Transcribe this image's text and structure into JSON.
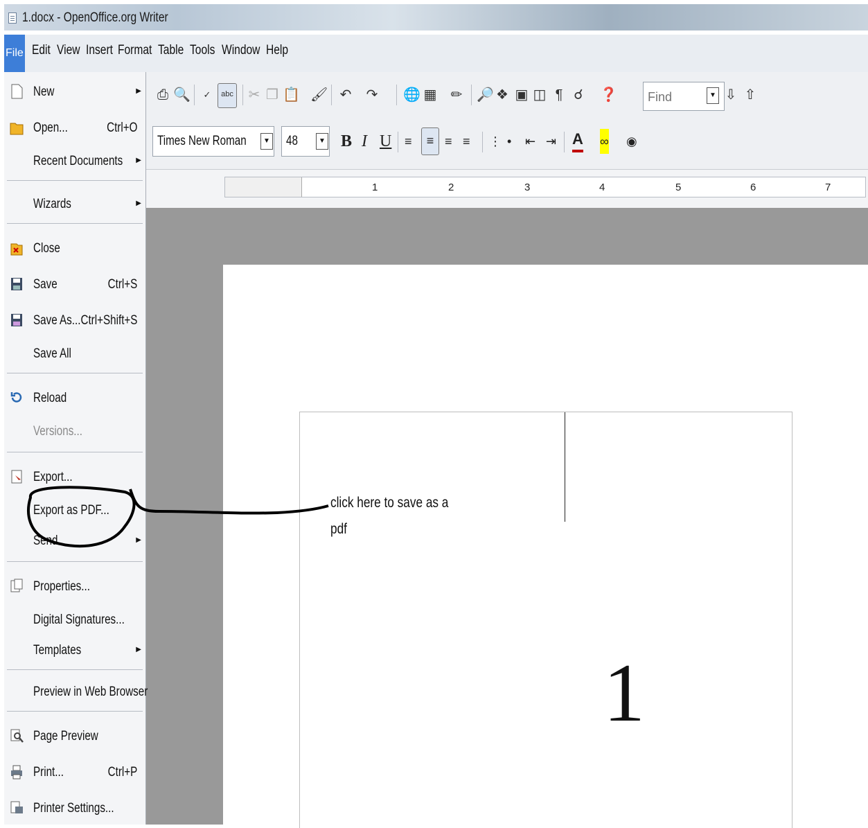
{
  "window": {
    "title": "1.docx - OpenOffice.org Writer"
  },
  "menubar": {
    "items": [
      "File",
      "Edit",
      "View",
      "Insert",
      "Format",
      "Table",
      "Tools",
      "Window",
      "Help"
    ]
  },
  "toolbar": {
    "find_placeholder": "Find",
    "font_name": "Times New Roman",
    "font_size": "48",
    "bold_label": "B",
    "italic_label": "I",
    "underline_label": "U"
  },
  "ruler": {
    "numbers": [
      "1",
      "2",
      "3",
      "4",
      "5",
      "6",
      "7"
    ]
  },
  "file_menu": {
    "items": [
      {
        "label": "New",
        "shortcut": "",
        "submenu": true
      },
      {
        "label": "Open...",
        "shortcut": "Ctrl+O",
        "submenu": false
      },
      {
        "label": "Recent Documents",
        "shortcut": "",
        "submenu": true
      },
      {
        "label": "Wizards",
        "shortcut": "",
        "submenu": true
      },
      {
        "label": "Close",
        "shortcut": "",
        "submenu": false
      },
      {
        "label": "Save",
        "shortcut": "Ctrl+S",
        "submenu": false
      },
      {
        "label": "Save As...",
        "shortcut": "Ctrl+Shift+S",
        "submenu": false
      },
      {
        "label": "Save All",
        "shortcut": "",
        "submenu": false
      },
      {
        "label": "Reload",
        "shortcut": "",
        "submenu": false
      },
      {
        "label": "Versions...",
        "shortcut": "",
        "submenu": false,
        "disabled": true
      },
      {
        "label": "Export...",
        "shortcut": "",
        "submenu": false
      },
      {
        "label": "Export as PDF...",
        "shortcut": "",
        "submenu": false
      },
      {
        "label": "Send",
        "shortcut": "",
        "submenu": true
      },
      {
        "label": "Properties...",
        "shortcut": "",
        "submenu": false
      },
      {
        "label": "Digital Signatures...",
        "shortcut": "",
        "submenu": false
      },
      {
        "label": "Templates",
        "shortcut": "",
        "submenu": true
      },
      {
        "label": "Preview in Web Browser",
        "shortcut": "",
        "submenu": false
      },
      {
        "label": "Page Preview",
        "shortcut": "",
        "submenu": false
      },
      {
        "label": "Print...",
        "shortcut": "Ctrl+P",
        "submenu": false
      },
      {
        "label": "Printer Settings...",
        "shortcut": "",
        "submenu": false
      }
    ]
  },
  "document": {
    "annotation_line1": "click here to save as a",
    "annotation_line2": "pdf",
    "content": "1"
  },
  "colors": {
    "menu_highlight": "#3d7ed8",
    "workspace": "#999999",
    "annotation_ink": "#000000"
  }
}
